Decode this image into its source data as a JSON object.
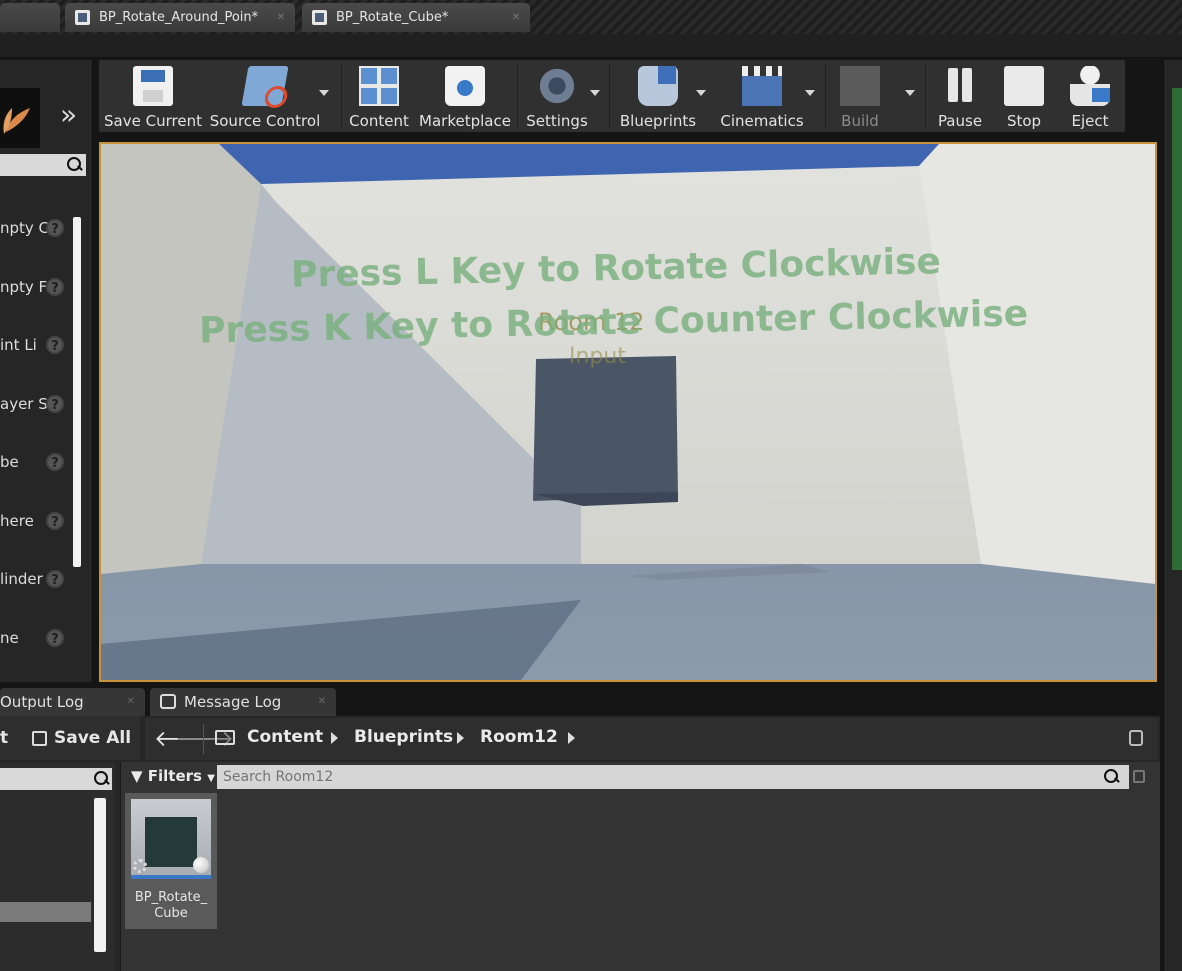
{
  "tabs": [
    {
      "label": "BP_Rotate_Around_Poin*"
    },
    {
      "label": "BP_Rotate_Cube*"
    }
  ],
  "modes_panel": {
    "items": [
      {
        "label": "npty C"
      },
      {
        "label": "npty F"
      },
      {
        "label": "int Li"
      },
      {
        "label": "ayer S"
      },
      {
        "label": "be"
      },
      {
        "label": "here"
      },
      {
        "label": "linder"
      },
      {
        "label": "ne"
      }
    ],
    "help_glyph": "?"
  },
  "toolbar": {
    "save_current": "Save Current",
    "source_control": "Source Control",
    "content": "Content",
    "marketplace": "Marketplace",
    "settings": "Settings",
    "blueprints": "Blueprints",
    "cinematics": "Cinematics",
    "build": "Build",
    "pause": "Pause",
    "stop": "Stop",
    "eject": "Eject"
  },
  "viewport": {
    "line1": "Press L Key to Rotate Clockwise",
    "line2": "Press K Key to Rotate Counter Clockwise",
    "room_label": "Room 12",
    "input_label": "Input"
  },
  "bottom_tabs": {
    "output_log": "Output Log",
    "message_log": "Message Log"
  },
  "content_browser": {
    "truncated_left": "t",
    "save_all": "Save All",
    "breadcrumbs": [
      "Content",
      "Blueprints",
      "Room12"
    ],
    "filters": "Filters",
    "search_placeholder": "Search Room12",
    "assets": [
      {
        "name": "BP_Rotate_\nCube"
      }
    ]
  },
  "colors": {
    "viewport_border": "#c4933c",
    "accent_blue": "#3a6ec7",
    "hint_text_green": "#78af7d"
  }
}
